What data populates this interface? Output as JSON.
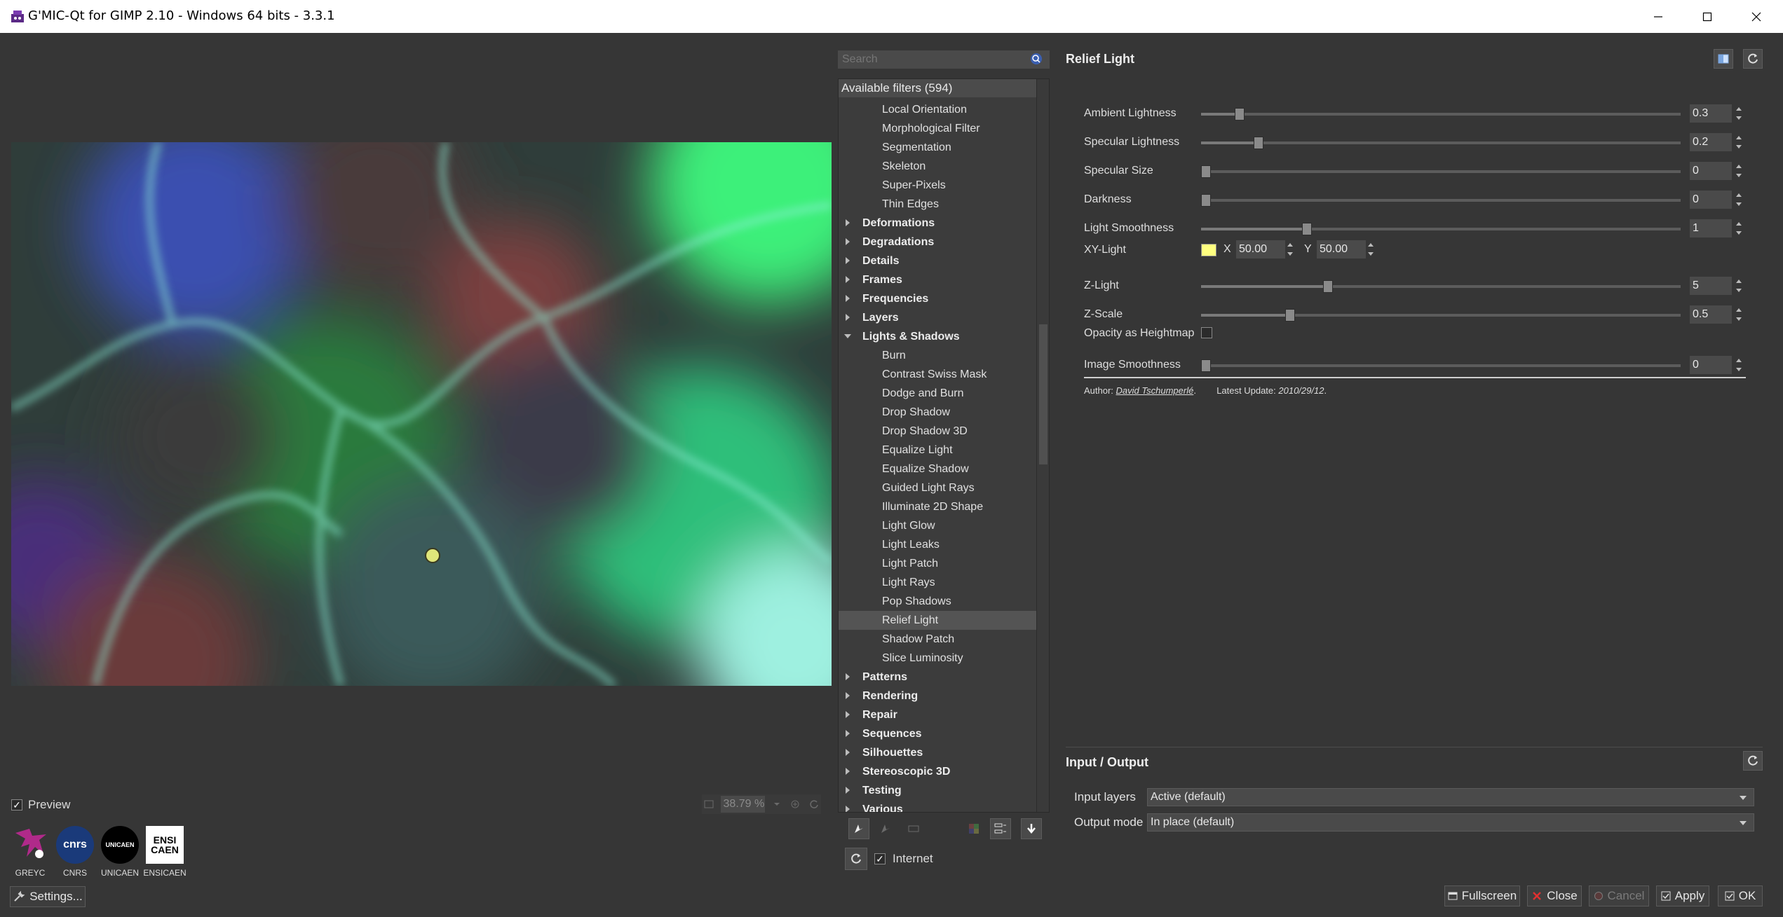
{
  "window": {
    "title": "G'MIC-Qt for GIMP 2.10 - Windows 64 bits - 3.3.1",
    "minimize_glyph": "—",
    "maximize_glyph": "☐",
    "close_glyph": "✕"
  },
  "preview": {
    "checkbox_label": "Preview",
    "checked": true,
    "zoom": "38.79 %"
  },
  "logos": [
    {
      "mark": "",
      "label": "GREYC"
    },
    {
      "mark": "cnrs",
      "label": "CNRS"
    },
    {
      "mark": "UNICAEN",
      "label": "UNICAEN"
    },
    {
      "mark": "ENSI CAEN",
      "label": "ENSICAEN"
    }
  ],
  "settings_button": "Settings...",
  "search": {
    "placeholder": "Search"
  },
  "tree": {
    "header": "Available filters (594)",
    "items": [
      {
        "label": "Local Orientation",
        "kind": "child"
      },
      {
        "label": "Morphological Filter",
        "kind": "child"
      },
      {
        "label": "Segmentation",
        "kind": "child"
      },
      {
        "label": "Skeleton",
        "kind": "child"
      },
      {
        "label": "Super-Pixels",
        "kind": "child"
      },
      {
        "label": "Thin Edges",
        "kind": "child"
      },
      {
        "label": "Deformations",
        "kind": "folder"
      },
      {
        "label": "Degradations",
        "kind": "folder"
      },
      {
        "label": "Details",
        "kind": "folder"
      },
      {
        "label": "Frames",
        "kind": "folder"
      },
      {
        "label": "Frequencies",
        "kind": "folder"
      },
      {
        "label": "Layers",
        "kind": "folder"
      },
      {
        "label": "Lights & Shadows",
        "kind": "folder-open"
      },
      {
        "label": "Burn",
        "kind": "child"
      },
      {
        "label": "Contrast Swiss Mask",
        "kind": "child"
      },
      {
        "label": "Dodge and Burn",
        "kind": "child"
      },
      {
        "label": "Drop Shadow",
        "kind": "child"
      },
      {
        "label": "Drop Shadow 3D",
        "kind": "child"
      },
      {
        "label": "Equalize Light",
        "kind": "child"
      },
      {
        "label": "Equalize Shadow",
        "kind": "child"
      },
      {
        "label": "Guided Light Rays",
        "kind": "child"
      },
      {
        "label": "Illuminate 2D Shape",
        "kind": "child"
      },
      {
        "label": "Light Glow",
        "kind": "child"
      },
      {
        "label": "Light Leaks",
        "kind": "child"
      },
      {
        "label": "Light Patch",
        "kind": "child"
      },
      {
        "label": "Light Rays",
        "kind": "child"
      },
      {
        "label": "Pop Shadows",
        "kind": "child"
      },
      {
        "label": "Relief Light",
        "kind": "child",
        "selected": true
      },
      {
        "label": "Shadow Patch",
        "kind": "child"
      },
      {
        "label": "Slice Luminosity",
        "kind": "child"
      },
      {
        "label": "Patterns",
        "kind": "folder"
      },
      {
        "label": "Rendering",
        "kind": "folder"
      },
      {
        "label": "Repair",
        "kind": "folder"
      },
      {
        "label": "Sequences",
        "kind": "folder"
      },
      {
        "label": "Silhouettes",
        "kind": "folder"
      },
      {
        "label": "Stereoscopic 3D",
        "kind": "folder"
      },
      {
        "label": "Testing",
        "kind": "folder"
      },
      {
        "label": "Various",
        "kind": "folder"
      }
    ]
  },
  "internet": {
    "label": "Internet",
    "checked": true
  },
  "filter": {
    "title": "Relief Light",
    "params": [
      {
        "label": "Ambient Lightness",
        "value": "0.3",
        "fraction": 0.07
      },
      {
        "label": "Specular Lightness",
        "value": "0.2",
        "fraction": 0.11
      },
      {
        "label": "Specular Size",
        "value": "0",
        "fraction": 0.0
      },
      {
        "label": "Darkness",
        "value": "0",
        "fraction": 0.0
      },
      {
        "label": "Light Smoothness",
        "value": "1",
        "fraction": 0.21
      },
      {
        "label": "Z-Light",
        "value": "5",
        "fraction": 0.255
      },
      {
        "label": "Z-Scale",
        "value": "0.5",
        "fraction": 0.175
      },
      {
        "label": "Image Smoothness",
        "value": "0",
        "fraction": 0.0
      }
    ],
    "xy_light": {
      "label": "XY-Light",
      "x_label": "X",
      "x": "50.00",
      "y_label": "Y",
      "y": "50.00",
      "color": "#ffff80"
    },
    "opacity_heightmap": {
      "label": "Opacity as Heightmap",
      "checked": false
    },
    "author_prefix": "Author: ",
    "author_name": "David Tschumperlé",
    "author_suffix": ".",
    "update_prefix": "Latest Update: ",
    "update_date": "2010/29/12",
    "update_suffix": "."
  },
  "io": {
    "title": "Input / Output",
    "input_label": "Input layers",
    "input_value": "Active (default)",
    "output_label": "Output mode",
    "output_value": "In place (default)"
  },
  "buttons": {
    "fullscreen": "Fullscreen",
    "close": "Close",
    "cancel": "Cancel",
    "apply": "Apply",
    "ok": "OK"
  },
  "colors": {
    "background": "#363636",
    "panel": "#3c3c3c",
    "selected": "#545454",
    "handle": "#e0e67a"
  }
}
